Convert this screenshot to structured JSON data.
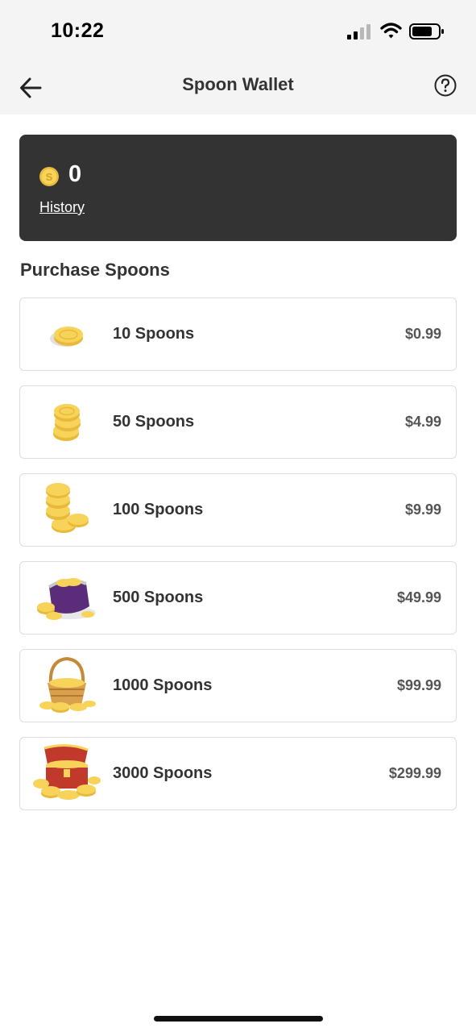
{
  "status_bar": {
    "time": "10:22"
  },
  "nav": {
    "title": "Spoon Wallet",
    "back_icon": "arrow-left-icon",
    "help_icon": "question-circle-icon"
  },
  "wallet": {
    "balance": "0",
    "history_label": "History",
    "coin_icon": "spoon-coin-icon"
  },
  "purchase": {
    "title": "Purchase Spoons",
    "packages": [
      {
        "name": "10 Spoons",
        "price": "$0.99",
        "icon": "single-coin-icon"
      },
      {
        "name": "50 Spoons",
        "price": "$4.99",
        "icon": "coin-stack-icon"
      },
      {
        "name": "100 Spoons",
        "price": "$9.99",
        "icon": "coin-pile-icon"
      },
      {
        "name": "500 Spoons",
        "price": "$49.99",
        "icon": "coin-purse-icon"
      },
      {
        "name": "1000 Spoons",
        "price": "$99.99",
        "icon": "coin-basket-icon"
      },
      {
        "name": "3000 Spoons",
        "price": "$299.99",
        "icon": "treasure-chest-icon"
      }
    ]
  },
  "colors": {
    "card_bg": "#333333",
    "coin_gold": "#f7d35a",
    "nav_bg": "#f4f4f4"
  }
}
